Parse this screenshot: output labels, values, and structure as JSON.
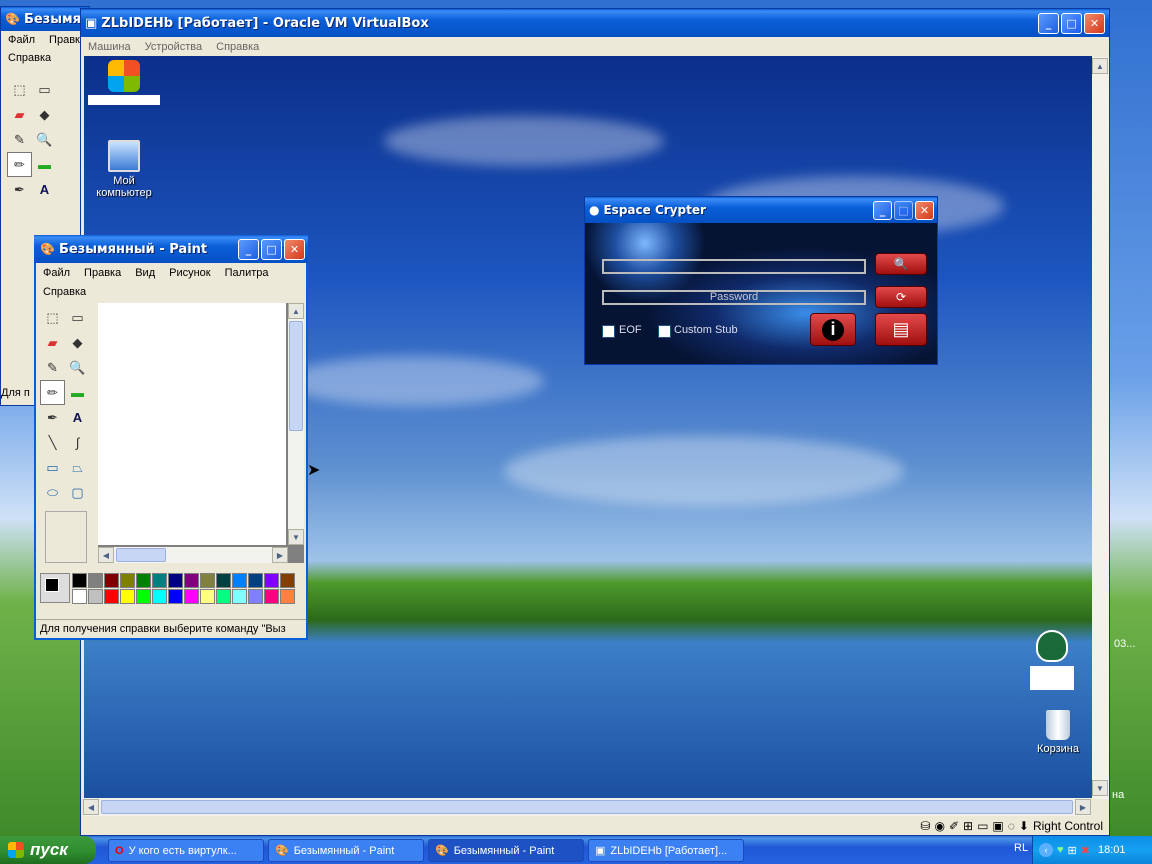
{
  "host_paint": {
    "title": "Безымян",
    "menu": [
      "Файл",
      "Правка",
      "Справка"
    ],
    "status": "Для п"
  },
  "vbox": {
    "title": "ZLbIDEHb [Работает] - Oracle VM VirtualBox",
    "menu": [
      "Машина",
      "Устройства",
      "Справка"
    ],
    "status_text": "Right Control"
  },
  "desktop": {
    "icons": [
      {
        "label": "Мой компьютер",
        "icon": "my-computer-icon"
      },
      {
        "label": "Корзина",
        "icon": "recycle-bin-icon"
      }
    ]
  },
  "paint": {
    "title": "Безымянный - Paint",
    "menu": [
      "Файл",
      "Правка",
      "Вид",
      "Рисунок",
      "Палитра",
      "Справка"
    ],
    "status": "Для получения справки выберите команду \"Выз",
    "palette_top": [
      "#000000",
      "#808080",
      "#800000",
      "#808000",
      "#008000",
      "#008080",
      "#000080",
      "#800080",
      "#808040",
      "#004040",
      "#0080ff",
      "#004080",
      "#8000ff",
      "#804000"
    ],
    "palette_bottom": [
      "#ffffff",
      "#c0c0c0",
      "#ff0000",
      "#ffff00",
      "#00ff00",
      "#00ffff",
      "#0000ff",
      "#ff00ff",
      "#ffff80",
      "#00ff80",
      "#80ffff",
      "#8080ff",
      "#ff0080",
      "#ff8040"
    ]
  },
  "crypter": {
    "title": "Espace Crypter",
    "password_label": "Password",
    "eof_label": "EOF",
    "stub_label": "Custom Stub"
  },
  "taskbar": {
    "start_label": "пуск",
    "tasks": [
      {
        "label": "У кого есть виртулк...",
        "icon": "opera-icon"
      },
      {
        "label": "Безымянный - Paint",
        "icon": "paint-icon"
      },
      {
        "label": "Безымянный - Paint",
        "icon": "paint-icon"
      },
      {
        "label": "ZLbIDEHb [Работает]...",
        "icon": "virtualbox-icon"
      }
    ],
    "lang": "RL",
    "time": "18:01"
  },
  "host_edge": {
    "text1": "03...",
    "text2": "на"
  }
}
